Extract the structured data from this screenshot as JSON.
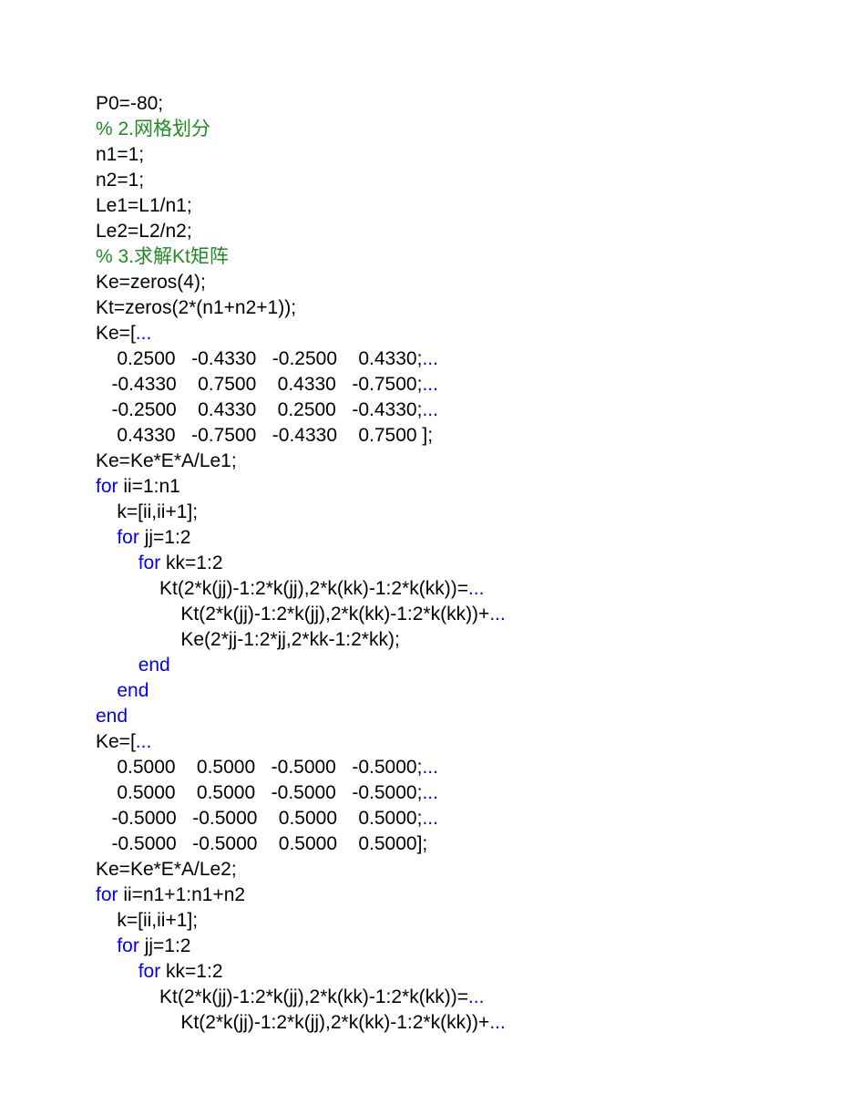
{
  "code": {
    "lines": [
      {
        "indent": 0,
        "segments": [
          {
            "t": "P0=-80;",
            "c": ""
          }
        ]
      },
      {
        "indent": 0,
        "segments": [
          {
            "t": "% 2.网格划分",
            "c": "cm"
          }
        ]
      },
      {
        "indent": 0,
        "segments": [
          {
            "t": "n1=1;",
            "c": ""
          }
        ]
      },
      {
        "indent": 0,
        "segments": [
          {
            "t": "n2=1;",
            "c": ""
          }
        ]
      },
      {
        "indent": 0,
        "segments": [
          {
            "t": "Le1=L1/n1;",
            "c": ""
          }
        ]
      },
      {
        "indent": 0,
        "segments": [
          {
            "t": "Le2=L2/n2;",
            "c": ""
          }
        ]
      },
      {
        "indent": 0,
        "segments": [
          {
            "t": "% 3.求解Kt矩阵",
            "c": "cm"
          }
        ]
      },
      {
        "indent": 0,
        "segments": [
          {
            "t": "Ke=zeros(4);",
            "c": ""
          }
        ]
      },
      {
        "indent": 0,
        "segments": [
          {
            "t": "Kt=zeros(2*(n1+n2+1));",
            "c": ""
          }
        ]
      },
      {
        "indent": 0,
        "segments": [
          {
            "t": "Ke=[",
            "c": ""
          },
          {
            "t": "...",
            "c": "ct"
          }
        ]
      },
      {
        "indent": 0,
        "segments": [
          {
            "t": "    0.2500   -0.4330   -0.2500    0.4330;",
            "c": ""
          },
          {
            "t": "...",
            "c": "ct"
          }
        ]
      },
      {
        "indent": 0,
        "segments": [
          {
            "t": "   -0.4330    0.7500    0.4330   -0.7500;",
            "c": ""
          },
          {
            "t": "...",
            "c": "ct"
          }
        ]
      },
      {
        "indent": 0,
        "segments": [
          {
            "t": "   -0.2500    0.4330    0.2500   -0.4330;",
            "c": ""
          },
          {
            "t": "...",
            "c": "ct"
          }
        ]
      },
      {
        "indent": 0,
        "segments": [
          {
            "t": "    0.4330   -0.7500   -0.4330    0.7500 ];",
            "c": ""
          }
        ]
      },
      {
        "indent": 0,
        "segments": [
          {
            "t": "Ke=Ke*E*A/Le1;",
            "c": ""
          }
        ]
      },
      {
        "indent": 0,
        "segments": [
          {
            "t": "for",
            "c": "kw"
          },
          {
            "t": " ii=1:n1",
            "c": ""
          }
        ]
      },
      {
        "indent": 1,
        "segments": [
          {
            "t": "k=[ii,ii+1];",
            "c": ""
          }
        ]
      },
      {
        "indent": 1,
        "segments": [
          {
            "t": "for",
            "c": "kw"
          },
          {
            "t": " jj=1:2",
            "c": ""
          }
        ]
      },
      {
        "indent": 2,
        "segments": [
          {
            "t": "for",
            "c": "kw"
          },
          {
            "t": " kk=1:2",
            "c": ""
          }
        ]
      },
      {
        "indent": 3,
        "segments": [
          {
            "t": "Kt(2*k(jj)-1:2*k(jj),2*k(kk)-1:2*k(kk))=",
            "c": ""
          },
          {
            "t": "...",
            "c": "ct"
          }
        ]
      },
      {
        "indent": 4,
        "segments": [
          {
            "t": "Kt(2*k(jj)-1:2*k(jj),2*k(kk)-1:2*k(kk))+",
            "c": ""
          },
          {
            "t": "...",
            "c": "ct"
          }
        ]
      },
      {
        "indent": 4,
        "segments": [
          {
            "t": "Ke(2*jj-1:2*jj,2*kk-1:2*kk);",
            "c": ""
          }
        ]
      },
      {
        "indent": 2,
        "segments": [
          {
            "t": "end",
            "c": "kw"
          }
        ]
      },
      {
        "indent": 1,
        "segments": [
          {
            "t": "end",
            "c": "kw"
          }
        ]
      },
      {
        "indent": 0,
        "segments": [
          {
            "t": "end",
            "c": "kw"
          }
        ]
      },
      {
        "indent": 0,
        "segments": [
          {
            "t": "Ke=[",
            "c": ""
          },
          {
            "t": "...",
            "c": "ct"
          }
        ]
      },
      {
        "indent": 0,
        "segments": [
          {
            "t": "    0.5000    0.5000   -0.5000   -0.5000;",
            "c": ""
          },
          {
            "t": "...",
            "c": "ct"
          }
        ]
      },
      {
        "indent": 0,
        "segments": [
          {
            "t": "    0.5000    0.5000   -0.5000   -0.5000;",
            "c": ""
          },
          {
            "t": "...",
            "c": "ct"
          }
        ]
      },
      {
        "indent": 0,
        "segments": [
          {
            "t": "   -0.5000   -0.5000    0.5000    0.5000;",
            "c": ""
          },
          {
            "t": "...",
            "c": "ct"
          }
        ]
      },
      {
        "indent": 0,
        "segments": [
          {
            "t": "   -0.5000   -0.5000    0.5000    0.5000];",
            "c": ""
          }
        ]
      },
      {
        "indent": 0,
        "segments": [
          {
            "t": "Ke=Ke*E*A/Le2;",
            "c": ""
          }
        ]
      },
      {
        "indent": 0,
        "segments": [
          {
            "t": "for",
            "c": "kw"
          },
          {
            "t": " ii=n1+1:n1+n2",
            "c": ""
          }
        ]
      },
      {
        "indent": 1,
        "segments": [
          {
            "t": "k=[ii,ii+1];",
            "c": ""
          }
        ]
      },
      {
        "indent": 1,
        "segments": [
          {
            "t": "for",
            "c": "kw"
          },
          {
            "t": " jj=1:2",
            "c": ""
          }
        ]
      },
      {
        "indent": 2,
        "segments": [
          {
            "t": "for",
            "c": "kw"
          },
          {
            "t": " kk=1:2",
            "c": ""
          }
        ]
      },
      {
        "indent": 3,
        "segments": [
          {
            "t": "Kt(2*k(jj)-1:2*k(jj),2*k(kk)-1:2*k(kk))=",
            "c": ""
          },
          {
            "t": "...",
            "c": "ct"
          }
        ]
      },
      {
        "indent": 4,
        "segments": [
          {
            "t": "Kt(2*k(jj)-1:2*k(jj),2*k(kk)-1:2*k(kk))+",
            "c": ""
          },
          {
            "t": "...",
            "c": "ct"
          }
        ]
      }
    ],
    "indent_unit": "    "
  }
}
